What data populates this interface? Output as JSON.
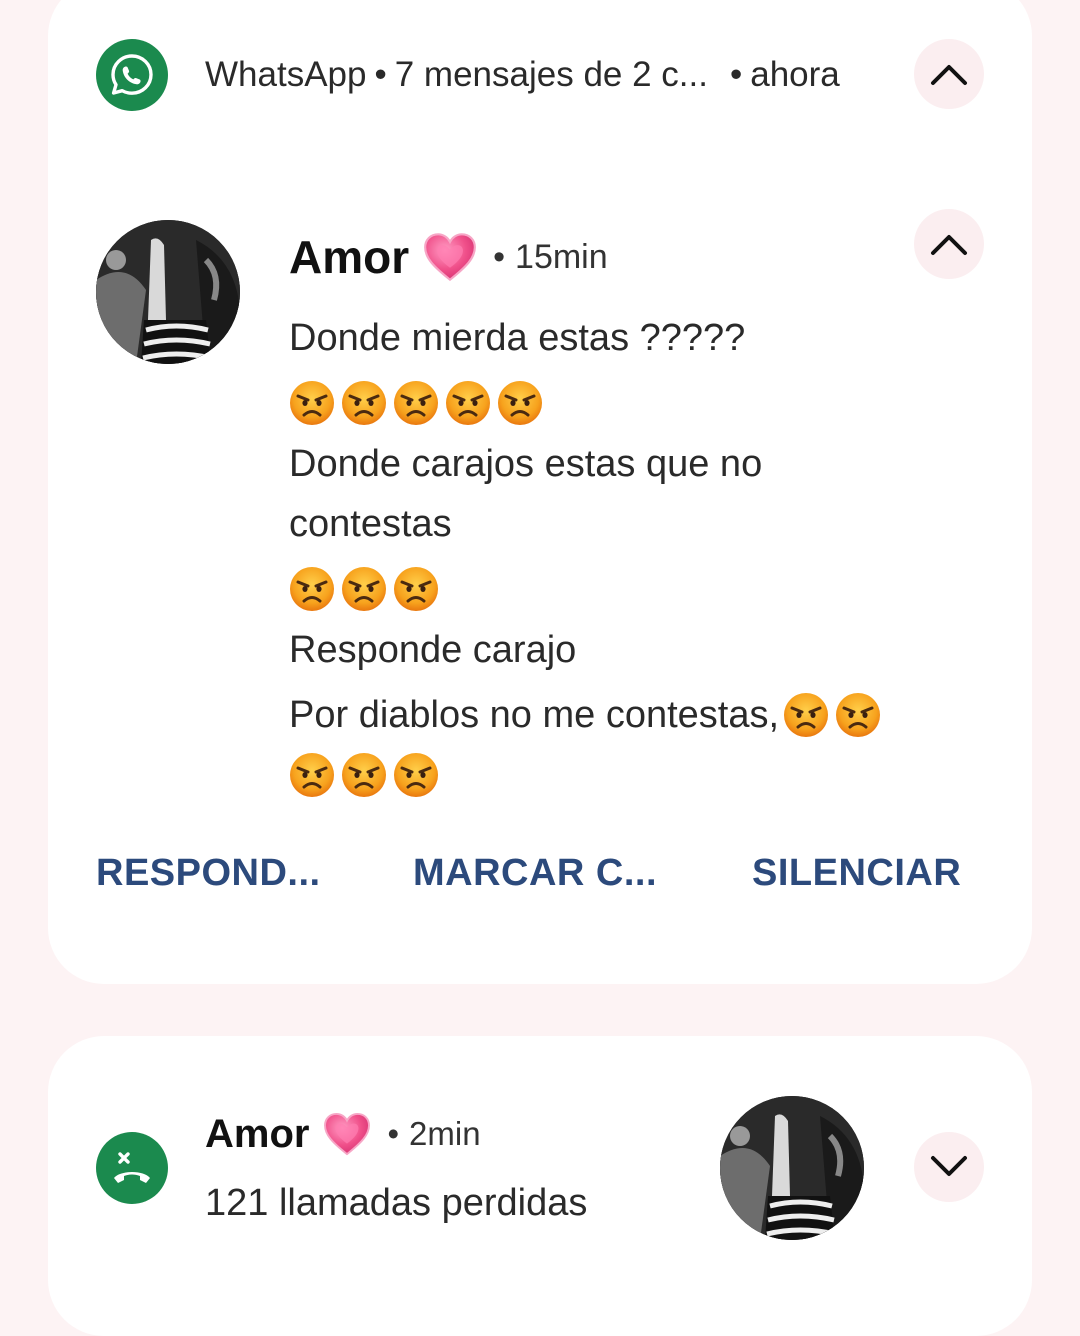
{
  "notification": {
    "app_name": "WhatsApp",
    "summary": "7 mensajes de 2 c...",
    "time": "ahora",
    "separator": "•"
  },
  "conversation": {
    "sender": "Amor",
    "time": "15min",
    "separator": "•",
    "lines": [
      "Donde mierda estas ?????",
      "Donde carajos estas que no",
      "contestas",
      "Responde carajo",
      "Por diablos no me contestas,"
    ]
  },
  "actions": {
    "reply": "RESPOND...",
    "mark": "MARCAR C...",
    "mute": "SILENCIAR"
  },
  "missed_calls": {
    "sender": "Amor",
    "time": "2min",
    "separator": "•",
    "text": "121 llamadas perdidas"
  },
  "colors": {
    "brand_green": "#1b8a4e",
    "action_blue": "#2c4a7c",
    "heart_pink": "#f0508a"
  },
  "icons": {
    "app": "whatsapp-icon",
    "collapse": "chevron-up-icon",
    "expand": "chevron-down-icon",
    "missed_call": "missed-call-icon",
    "emoji": "angry-face-emoji",
    "heart": "pink-heart-emoji"
  }
}
